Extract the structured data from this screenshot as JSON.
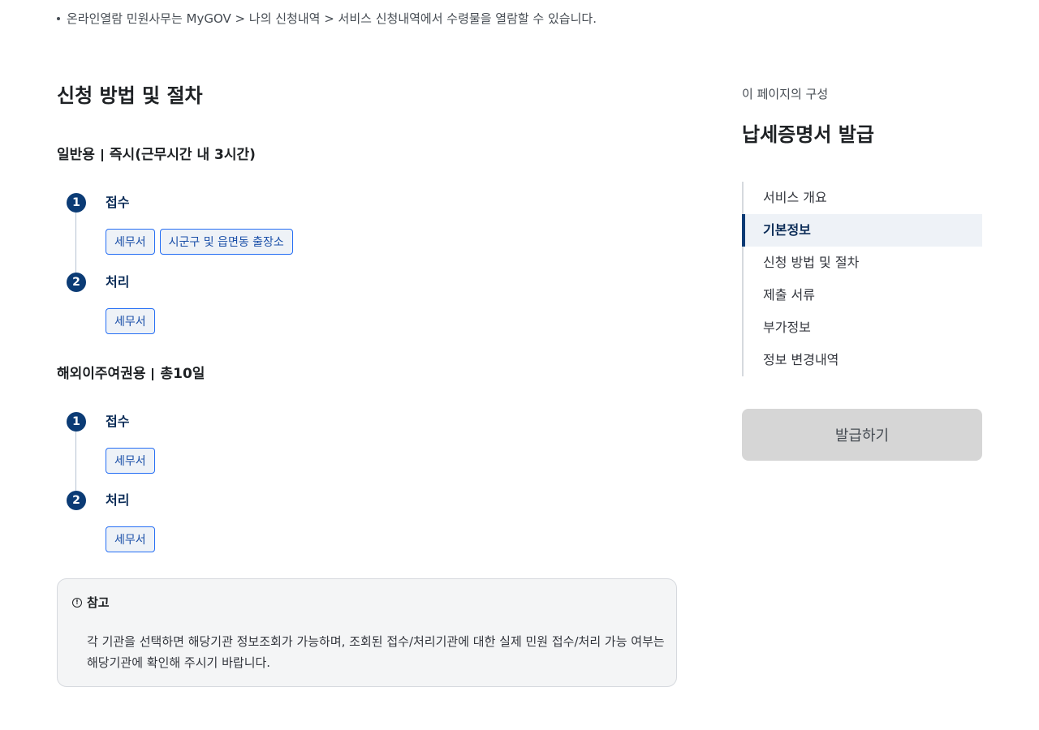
{
  "top_note": "온라인열람 민원사무는 MyGOV > 나의 신청내역 > 서비스 신청내역에서 수령물을 열람할 수 있습니다.",
  "main": {
    "section_title": "신청 방법 및 절차",
    "groups": [
      {
        "name": "일반용",
        "duration": "즉시(근무시간 내 3시간)",
        "steps": [
          {
            "num": "1",
            "label": "접수",
            "chips": [
              "세무서",
              "시군구 및 읍면동 출장소"
            ]
          },
          {
            "num": "2",
            "label": "처리",
            "chips": [
              "세무서"
            ]
          }
        ]
      },
      {
        "name": "해외이주여권용",
        "duration": "총10일",
        "steps": [
          {
            "num": "1",
            "label": "접수",
            "chips": [
              "세무서"
            ]
          },
          {
            "num": "2",
            "label": "처리",
            "chips": [
              "세무서"
            ]
          }
        ]
      }
    ],
    "reference": {
      "title": "참고",
      "body": "각 기관을 선택하면 해당기관 정보조회가 가능하며, 조회된 접수/처리기관에 대한 실제 민원 접수/처리 가능 여부는 해당기관에 확인해 주시기 바랍니다."
    }
  },
  "aside": {
    "kicker": "이 페이지의 구성",
    "title": "납세증명서 발급",
    "toc": [
      "서비스 개요",
      "기본정보",
      "신청 방법 및 절차",
      "제출 서류",
      "부가정보",
      "정보 변경내역"
    ],
    "active_index": 1,
    "issue_button": "발급하기"
  },
  "colors": {
    "accent": "#0b3b75",
    "chip_border": "#256ef4",
    "disabled_button": "#d6d6d6"
  }
}
